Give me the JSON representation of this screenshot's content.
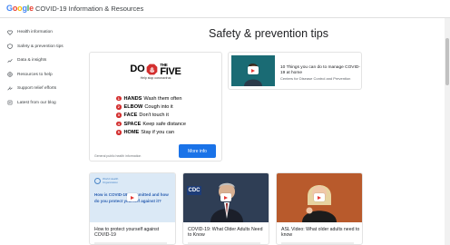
{
  "header": {
    "logo_letters": [
      {
        "ch": "G",
        "color": "#4285F4"
      },
      {
        "ch": "o",
        "color": "#EA4335"
      },
      {
        "ch": "o",
        "color": "#FBBC05"
      },
      {
        "ch": "g",
        "color": "#4285F4"
      },
      {
        "ch": "l",
        "color": "#34A853"
      },
      {
        "ch": "e",
        "color": "#EA4335"
      }
    ],
    "title": "COVID-19 Information & Resources"
  },
  "sidebar": {
    "items": [
      {
        "label": "Health information",
        "icon": "heart-icon"
      },
      {
        "label": "Safety & prevention tips",
        "icon": "shield-icon"
      },
      {
        "label": "Data & insights",
        "icon": "chart-icon"
      },
      {
        "label": "Resources to help",
        "icon": "globe-icon"
      },
      {
        "label": "Support relief efforts",
        "icon": "hands-icon"
      },
      {
        "label": "Latest from our blog",
        "icon": "doc-icon"
      }
    ]
  },
  "main": {
    "title": "Safety & prevention tips",
    "featured": {
      "heading_left": "DO",
      "heading_right": "THE",
      "heading_big": "FIVE",
      "subheading": "Help stop coronavirus",
      "steps": [
        {
          "num": "1",
          "keyword": "HANDS",
          "text": "Wash them often"
        },
        {
          "num": "2",
          "keyword": "ELBOW",
          "text": "Cough into it"
        },
        {
          "num": "3",
          "keyword": "FACE",
          "text": "Don't touch it"
        },
        {
          "num": "4",
          "keyword": "SPACE",
          "text": "Keep safe distance"
        },
        {
          "num": "5",
          "keyword": "HOME",
          "text": "Stay if you can"
        }
      ],
      "footer": "General public health information",
      "button_label": "More info"
    },
    "side_card": {
      "title": "10 Things you can do to manage COVID-19 at home",
      "source": "Centers for Disease Control and Prevention"
    },
    "videos": [
      {
        "title": "How to protect yourself against COVID-19",
        "thumb_text": "How is COVID-19 transmitted and how do you protect yourself against it?",
        "org": "World Health Organization"
      },
      {
        "title": "COVID-19: What Older Adults Need to Know",
        "thumb_text": "CDC"
      },
      {
        "title": "ASL Video: What older adults need to know"
      }
    ]
  }
}
